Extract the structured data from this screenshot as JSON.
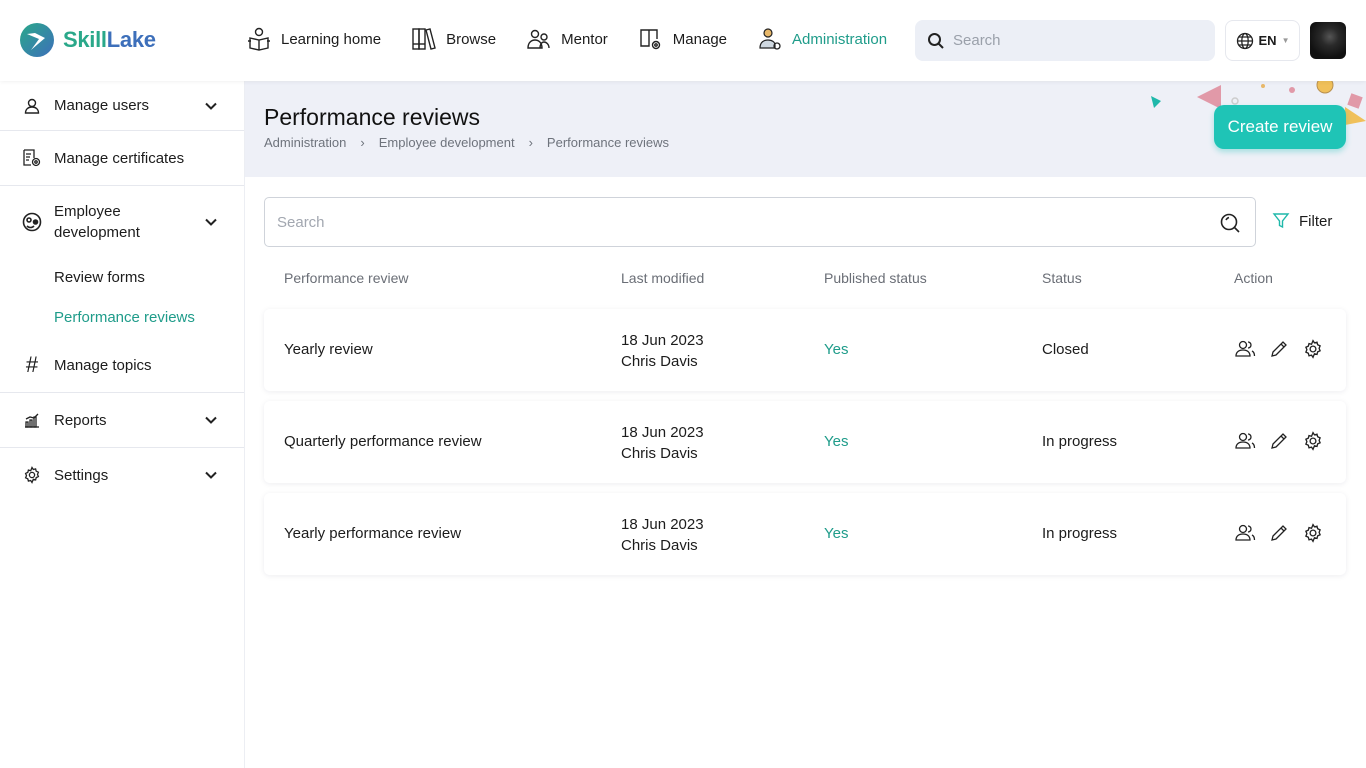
{
  "brand": {
    "name_part1": "Skill",
    "name_part2": "Lake"
  },
  "nav": [
    {
      "label": "Learning home",
      "icon": "reading-person-icon",
      "active": false
    },
    {
      "label": "Browse",
      "icon": "books-icon",
      "active": false
    },
    {
      "label": "Mentor",
      "icon": "mentor-icon",
      "active": false
    },
    {
      "label": "Manage",
      "icon": "manage-icon",
      "active": false
    },
    {
      "label": "Administration",
      "icon": "admin-user-gear-icon",
      "active": true
    }
  ],
  "top_search": {
    "placeholder": "Search"
  },
  "language": {
    "code": "EN"
  },
  "sidebar": {
    "items": [
      {
        "label": "Manage users",
        "icon": "user-icon",
        "expandable": true
      },
      {
        "label": "Manage certificates",
        "icon": "certificate-gear-icon",
        "expandable": false
      },
      {
        "label": "Employee development",
        "icon": "employee-development-icon",
        "expandable": true,
        "children": [
          {
            "label": "Review forms",
            "active": false
          },
          {
            "label": "Performance reviews",
            "active": true
          }
        ]
      },
      {
        "label": "Manage topics",
        "icon": "hash-icon",
        "expandable": false
      },
      {
        "label": "Reports",
        "icon": "chart-icon",
        "expandable": true
      },
      {
        "label": "Settings",
        "icon": "gear-icon",
        "expandable": true
      }
    ]
  },
  "page": {
    "title": "Performance reviews",
    "breadcrumb": [
      "Administration",
      "Employee development",
      "Performance reviews"
    ],
    "create_button": "Create review"
  },
  "search": {
    "placeholder": "Search"
  },
  "filter_label": "Filter",
  "table": {
    "headers": [
      "Performance review",
      "Last modified",
      "Published status",
      "Status",
      "Action"
    ],
    "rows": [
      {
        "name": "Yearly review",
        "date": "18 Jun 2023",
        "author": "Chris Davis",
        "published": "Yes",
        "status": "Closed"
      },
      {
        "name": "Quarterly performance review",
        "date": "18 Jun 2023",
        "author": "Chris Davis",
        "published": "Yes",
        "status": "In progress"
      },
      {
        "name": "Yearly performance review",
        "date": "18 Jun 2023",
        "author": "Chris Davis",
        "published": "Yes",
        "status": "In progress"
      }
    ]
  },
  "colors": {
    "accent": "#1f9c8a",
    "button": "#1fc4b6",
    "banner_bg": "#eef0f7"
  }
}
